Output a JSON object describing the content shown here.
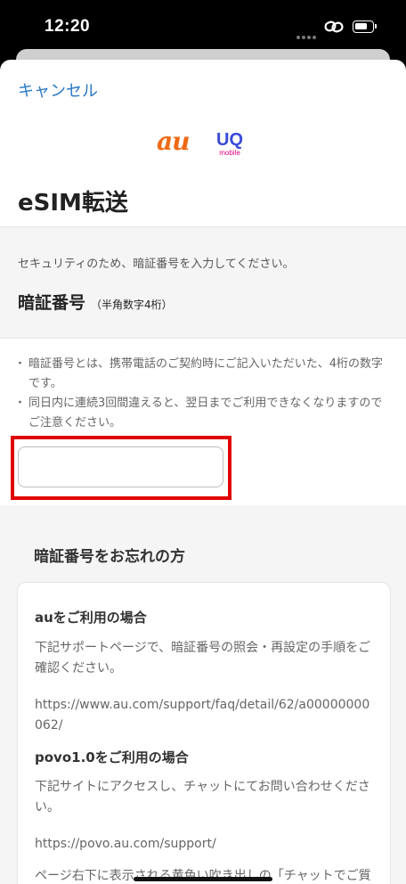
{
  "status_bar": {
    "time": "12:20",
    "icons": [
      "link-icon",
      "battery-icon"
    ]
  },
  "header": {
    "cancel_label": "キャンセル"
  },
  "brand": {
    "au_logo": "au",
    "uq_logo": "UQ",
    "uq_sub": "mobile",
    "colors": {
      "au": "#f06a14",
      "uq": "#3a4ad8",
      "uq_sub": "#e6007e"
    }
  },
  "page": {
    "title": "eSIM転送"
  },
  "security": {
    "text": "セキュリティのため、暗証番号を入力してください。",
    "pin_label": "暗証番号",
    "pin_hint": "（半角数字4桁）"
  },
  "notes": [
    "暗証番号とは、携帯電話のご契約時にご記入いただいた、4桁の数字です。",
    "同日内に連続3回間違えると、翌日までご利用できなくなりますのでご注意ください。"
  ],
  "pin_input": {
    "value": "",
    "placeholder": "",
    "highlight_color": "#e00000"
  },
  "forgot": {
    "title": "暗証番号をお忘れの方",
    "au_case": {
      "title": "auをご利用の場合",
      "text": "下記サポートページで、暗証番号の照会・再設定の手順をご確認ください。",
      "url": "https://www.au.com/support/faq/detail/62/a00000000062/"
    },
    "povo_case": {
      "title": "povo1.0をご利用の場合",
      "text": "下記サイトにアクセスし、チャットにてお問い合わせください。",
      "url": "https://povo.au.com/support/",
      "more_text": "ページ右下に表示される黄色い吹き出しの「チャットでご質問」に、以下の番号を入力してください。"
    }
  },
  "colors": {
    "accent": "#2a78c8",
    "section_bg": "#f5f5f5"
  }
}
